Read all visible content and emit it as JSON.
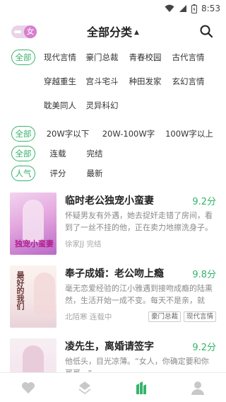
{
  "status_bar": {
    "time": "8:53"
  },
  "header": {
    "toggle_label": "女",
    "title": "全部分类",
    "title_arrow": "▲"
  },
  "filters": {
    "category": {
      "selected": "全部",
      "options": [
        "现代言情",
        "豪门总裁",
        "青春校园",
        "古代言情",
        "穿越重生",
        "宫斗宅斗",
        "种田发家",
        "玄幻言情",
        "耽美同人",
        "灵异科幻"
      ]
    },
    "word_count": {
      "selected": "全部",
      "options": [
        "20W字以下",
        "20W-100W字",
        "100W字以上"
      ]
    },
    "status": {
      "selected": "全部",
      "options": [
        "连载",
        "完结"
      ]
    },
    "sort": {
      "selected": "人气",
      "options": [
        "评分",
        "最新"
      ]
    }
  },
  "books": [
    {
      "title": "临时老公独宠小蛮妻",
      "score": "9.2分",
      "description": "怀疑男友有外遇，她去捉奸走错了房间，看到了一丝不挂的他，正在卖力地擦洗身子。她...",
      "meta": "徐家JJ 完结",
      "tags": [],
      "cover_text": "独宠小蛮妻"
    },
    {
      "title": "奉子成婚：老公吻上瘾",
      "score": "9.8分",
      "description": "毫无恋爱经验的江小雅遇到接吻成瘾的陆熏然，生活开始一成不变。每天不是亲，就是...",
      "meta": "北陌寒 连载中",
      "tags": [
        "豪门总裁",
        "现代言情"
      ],
      "cover_text": "最好的我们"
    },
    {
      "title": "凌先生，离婚请签字",
      "score": "9.2分",
      "description": "他低头，目光凉薄。“女人，你确定要和你哥哥...”",
      "meta": "",
      "tags": [],
      "cover_text": ""
    }
  ],
  "tabbar": {
    "items": [
      "heart-icon",
      "layers-icon",
      "library-icon",
      "profile-icon"
    ],
    "active_index": 2
  },
  "colors": {
    "accent": "#35b36a",
    "toggle": "#d77ed0"
  }
}
